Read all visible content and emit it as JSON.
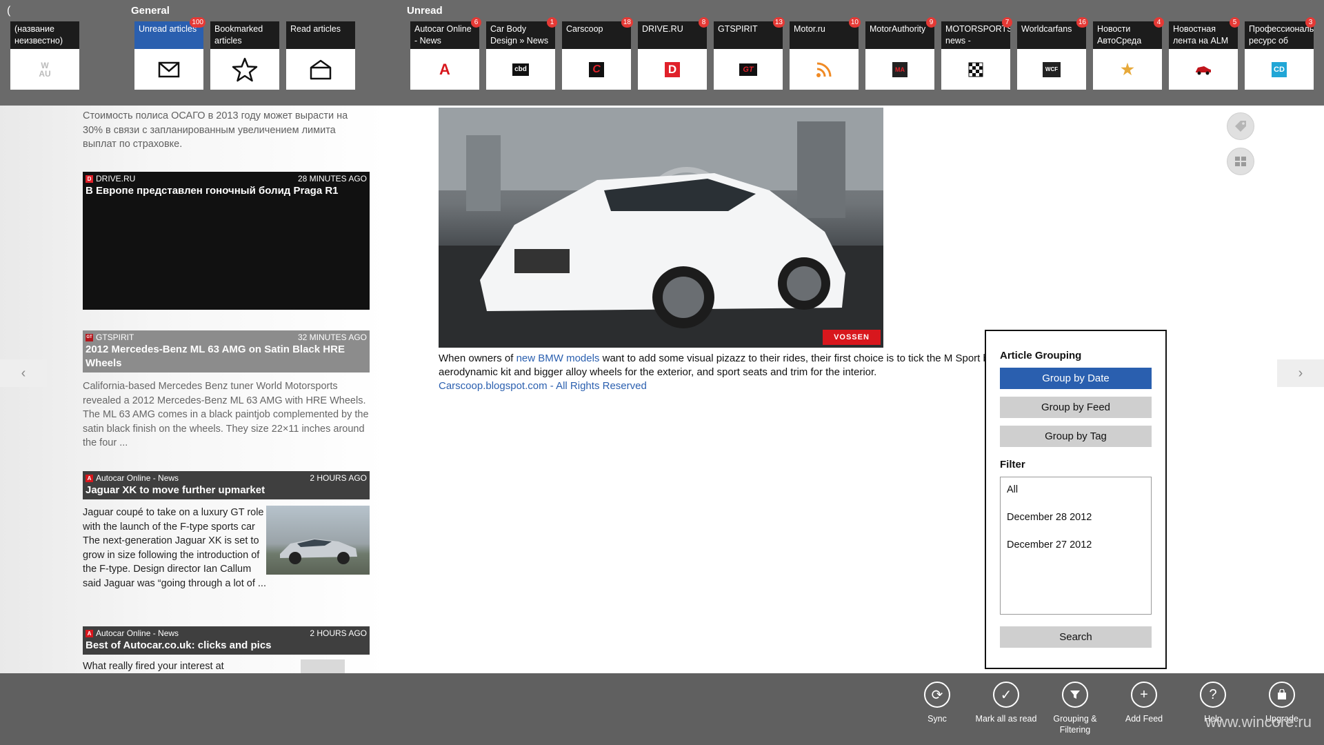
{
  "topbar": {
    "paren": "(",
    "general_label": "General",
    "unread_label": "Unread",
    "unknown_tile": {
      "name": "(название неизвестно)",
      "logo": "W AU"
    },
    "general_tiles": [
      {
        "name": "Unread articles",
        "badge": "100",
        "icon": "envelope-icon"
      },
      {
        "name": "Bookmarked articles",
        "icon": "star-icon"
      },
      {
        "name": "Read articles",
        "icon": "open-envelope-icon"
      }
    ],
    "feeds": [
      {
        "name": "Autocar Online - News",
        "badge": "6",
        "logo": "A",
        "color": "#d8171d"
      },
      {
        "name": "Car Body Design » News",
        "badge": "1",
        "logo": "cbd",
        "color": "#111111"
      },
      {
        "name": "Carscoop",
        "badge": "18",
        "logo": "C",
        "color": "#c0151c"
      },
      {
        "name": "DRIVE.RU",
        "badge": "8",
        "logo": "D",
        "color": "#e0212a"
      },
      {
        "name": "GTSPIRIT",
        "badge": "13",
        "logo": "GT",
        "color": "#b3151b"
      },
      {
        "name": "Motor.ru",
        "badge": "10",
        "logo": "rss",
        "color": "#f08a24"
      },
      {
        "name": "MotorAuthority",
        "badge": "9",
        "logo": "MA",
        "color": "#222222"
      },
      {
        "name": "MOTORSPORTS news -",
        "badge": "7",
        "logo": "flag",
        "color": "#111111"
      },
      {
        "name": "Worldcarfans",
        "badge": "16",
        "logo": "WCF",
        "color": "#222222"
      },
      {
        "name": "Новости АвтоСреда",
        "badge": "4",
        "logo": "★",
        "color": "#e7a93a"
      },
      {
        "name": "Новостная лента на ALM",
        "badge": "5",
        "logo": "car",
        "color": "#c0151c"
      },
      {
        "name": "Профессиональ ресурс об",
        "badge": "3",
        "logo": "CD",
        "color": "#21a6d6"
      }
    ]
  },
  "list": {
    "intro": "Стоимость полиса ОСАГО в 2013 году может вырасти на 30% в связи с запланированным увеличением лимита выплат по страховке.",
    "cards": [
      {
        "source": "DRIVE.RU",
        "time": "28 MINUTES AGO",
        "title": "В Европе представлен гоночный болид Praga R1"
      },
      {
        "source": "GTSPIRIT",
        "time": "32 MINUTES AGO",
        "title": "2012 Mercedes-Benz ML 63 AMG on Satin Black HRE Wheels",
        "text": "California-based Mercedes Benz tuner World Motorsports revealed a 2012 Mercedes-Benz ML 63 AMG with HRE Wheels. The ML 63 AMG comes in a black paintjob complemented by the satin black finish on the wheels. They size 22×11 inches around the four ..."
      },
      {
        "source": "Autocar Online - News",
        "time": "2 HOURS AGO",
        "title": "Jaguar XK to move further upmarket",
        "text": "Jaguar coupé to take on a luxury GT role with the launch of the F-type sports car The next-generation Jaguar XK is set to grow in size following the introduction of the F-type. Design director Ian Callum said Jaguar was “going through a lot of ..."
      },
      {
        "source": "Autocar Online - News",
        "time": "2 HOURS AGO",
        "title": "Best of Autocar.co.uk: clicks and pics",
        "text": "What really fired your interest at"
      }
    ]
  },
  "article": {
    "image_watermark": "VOSSEN",
    "text_before_link": "When owners of ",
    "link_text": "new BMW models",
    "text_after_link": " want to add some visual pizazz to their rides, their first choice is to tick the M Sport box, which usually comes with an aerodynamic kit and bigger alloy wheels for the exterior, and sport seats and trim for the interior.",
    "credit": "Carscoop.blogspot.com - All Rights Reserved"
  },
  "flyout": {
    "grouping_title": "Article Grouping",
    "group_by_date": "Group by Date",
    "group_by_feed": "Group by Feed",
    "group_by_tag": "Group by Tag",
    "filter_title": "Filter",
    "filter_options": [
      "All",
      "December 28 2012",
      "December 27 2012"
    ],
    "search": "Search"
  },
  "appbar": {
    "buttons": [
      {
        "label": "Sync",
        "icon": "sync-icon"
      },
      {
        "label": "Mark all as read",
        "icon": "check-icon"
      },
      {
        "label": "Grouping & Filtering",
        "icon": "filter-icon"
      },
      {
        "label": "Add Feed",
        "icon": "plus-icon"
      },
      {
        "label": "Help",
        "icon": "help-icon"
      },
      {
        "label": "Upgrade",
        "icon": "bag-icon"
      }
    ],
    "watermark": "www.wincore.ru"
  },
  "colors": {
    "accent": "#2a5faf",
    "badge": "#e53935",
    "topbar": "#6a6a6a",
    "appbar": "#606060"
  }
}
